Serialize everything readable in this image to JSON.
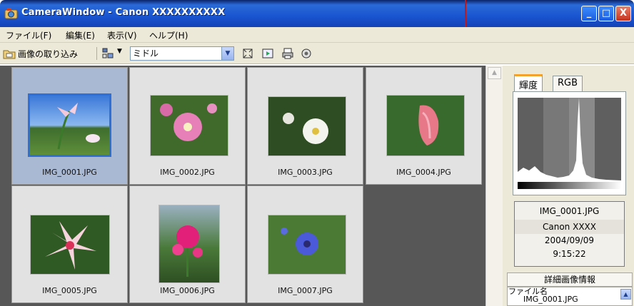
{
  "window": {
    "title": "CameraWindow - Canon XXXXXXXXXX",
    "minimize": "_",
    "maximize": "□",
    "close": "X"
  },
  "menu": [
    "ファイル(F)",
    "編集(E)",
    "表示(V)",
    "ヘルプ(H)"
  ],
  "toolbar": {
    "import_label": "画像の取り込み",
    "size_value": "ミドル",
    "size_arrow": "▼"
  },
  "thumbnails": [
    {
      "name": "IMG_0001.JPG",
      "selected": true
    },
    {
      "name": "IMG_0002.JPG",
      "selected": false
    },
    {
      "name": "IMG_0003.JPG",
      "selected": false
    },
    {
      "name": "IMG_0004.JPG",
      "selected": false
    },
    {
      "name": "IMG_0005.JPG",
      "selected": false
    },
    {
      "name": "IMG_0006.JPG",
      "selected": false
    },
    {
      "name": "IMG_0007.JPG",
      "selected": false
    }
  ],
  "scroll_up": "▲",
  "panel": {
    "tabs": [
      "輝度",
      "RGB"
    ],
    "active_tab": "輝度",
    "info": {
      "filename": "IMG_0001.JPG",
      "camera": "Canon XXXX",
      "date": "2004/09/09",
      "time": "9:15:22"
    },
    "detail_title": "詳細画像情報",
    "detail_label": "ファイル名",
    "detail_value": "IMG_0001.JPG",
    "detail_scroll": "▲"
  },
  "colors": {
    "titlebar": "#1a55d0",
    "grid_background": "#575757",
    "selected_thumb": "#a9b9d4",
    "selection_border": "#2f6fd6",
    "tab_accent": "#f3a22c"
  }
}
